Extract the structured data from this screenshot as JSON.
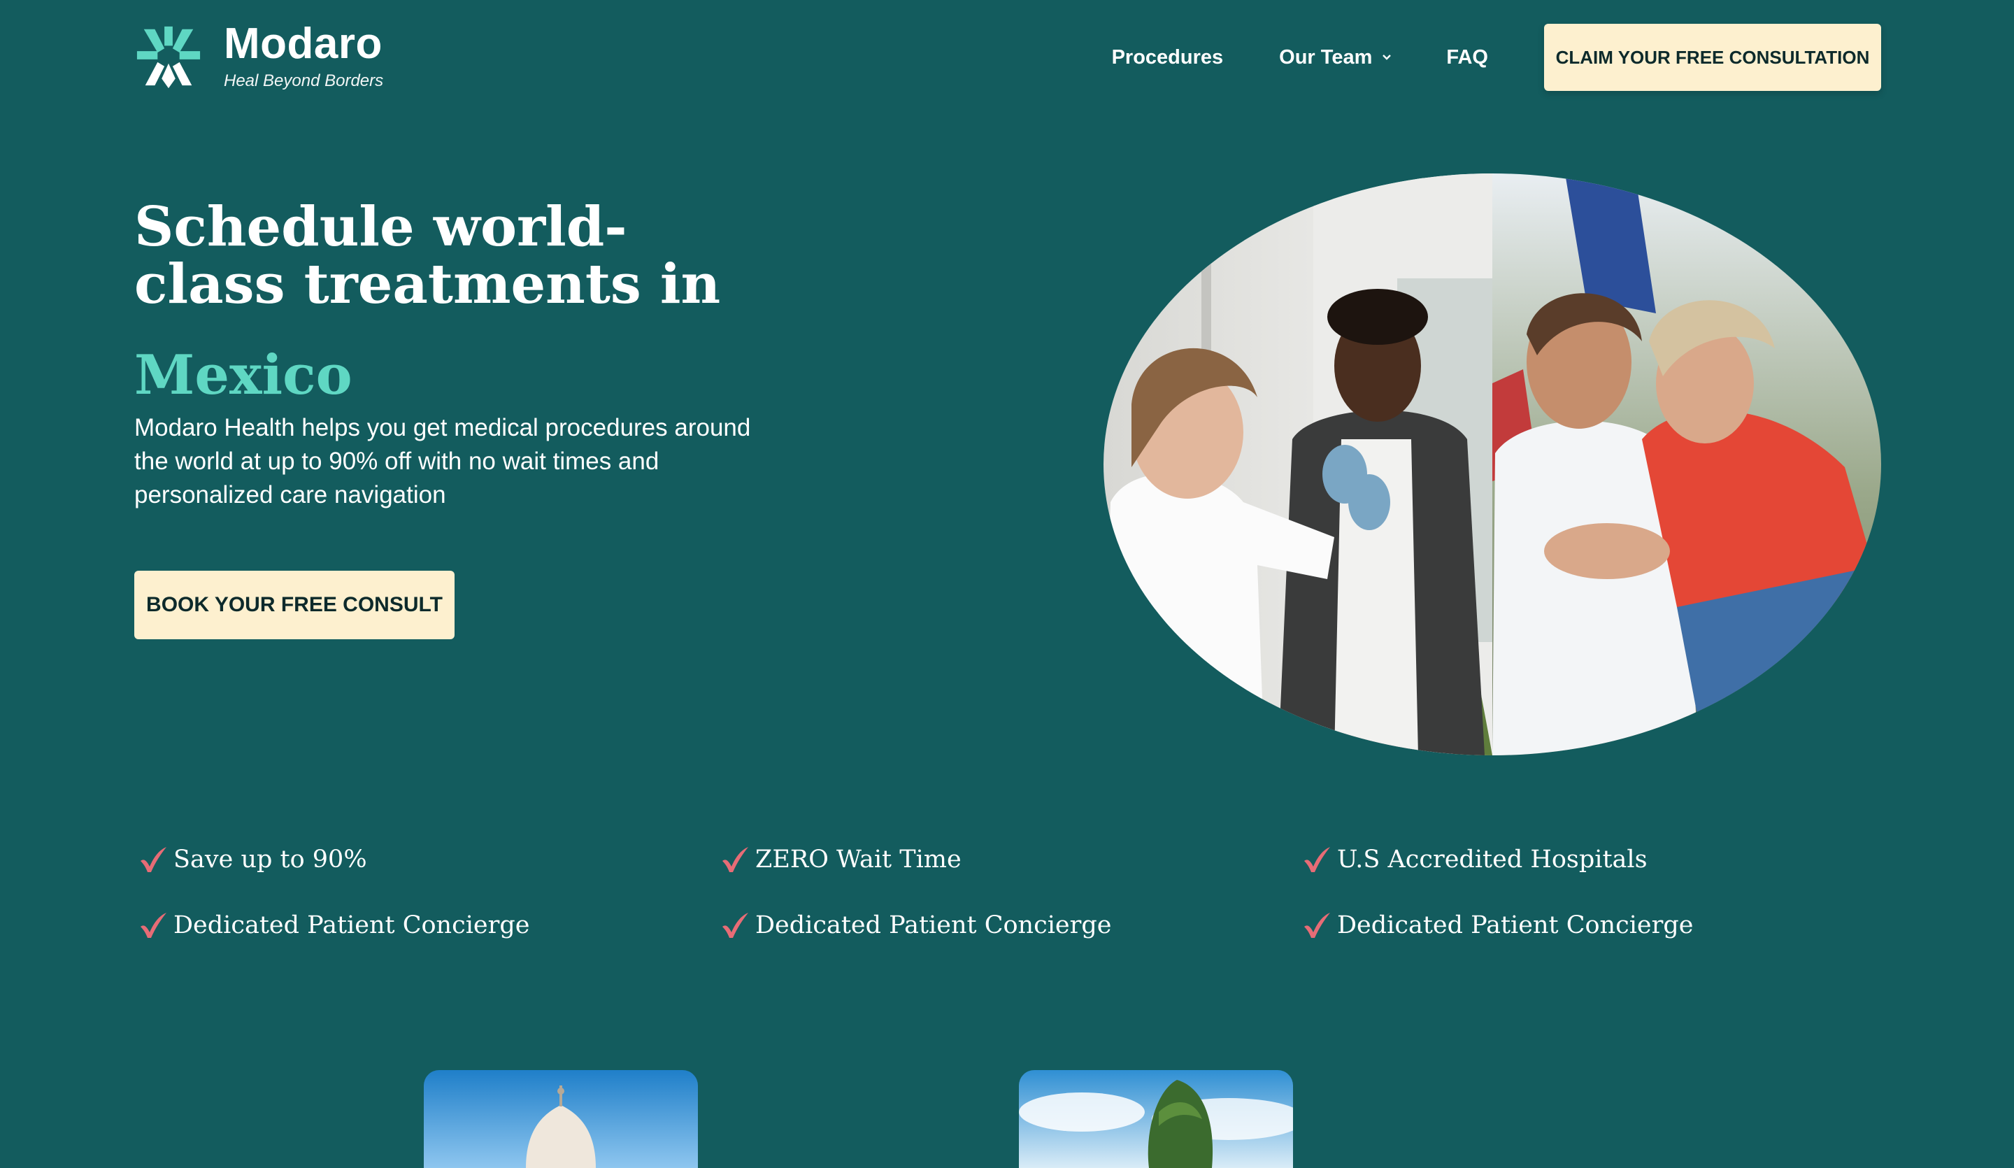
{
  "brand": {
    "name": "Modaro",
    "tagline": "Heal Beyond Borders"
  },
  "nav": {
    "items": [
      {
        "label": "Procedures"
      },
      {
        "label": "Our Team"
      },
      {
        "label": "FAQ"
      }
    ],
    "cta_label": "CLAIM YOUR FREE CONSULTATION"
  },
  "hero": {
    "headline": "Schedule world-class treatments in",
    "country": "Mexico",
    "subtext": "Modaro Health helps you get medical procedures around the world at up to 90% off with no wait times and personalized care navigation",
    "cta_label": "BOOK YOUR FREE CONSULT"
  },
  "benefits": [
    {
      "label": "Save up to 90%"
    },
    {
      "label": "ZERO Wait Time"
    },
    {
      "label": "U.S Accredited Hospitals"
    },
    {
      "label": "Dedicated Patient Concierge"
    },
    {
      "label": "Dedicated Patient Concierge"
    },
    {
      "label": "Dedicated Patient Concierge"
    }
  ],
  "colors": {
    "background": "#135c5e",
    "accent": "#5fd7c3",
    "button": "#fdf0cf",
    "check": "#e76c76"
  }
}
